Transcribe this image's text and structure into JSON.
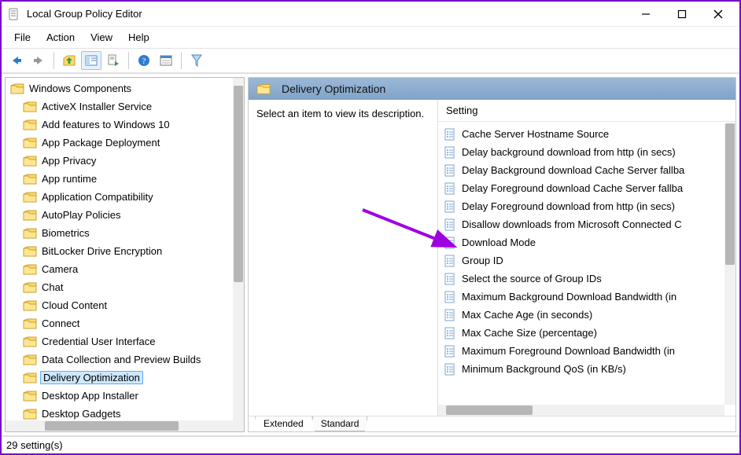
{
  "window": {
    "title": "Local Group Policy Editor"
  },
  "menu": {
    "file": "File",
    "action": "Action",
    "view": "View",
    "help": "Help"
  },
  "tree": {
    "root": "Windows Components",
    "items": [
      "ActiveX Installer Service",
      "Add features to Windows 10",
      "App Package Deployment",
      "App Privacy",
      "App runtime",
      "Application Compatibility",
      "AutoPlay Policies",
      "Biometrics",
      "BitLocker Drive Encryption",
      "Camera",
      "Chat",
      "Cloud Content",
      "Connect",
      "Credential User Interface",
      "Data Collection and Preview Builds",
      "Delivery Optimization",
      "Desktop App Installer",
      "Desktop Gadgets"
    ],
    "selected_index": 15
  },
  "details": {
    "header": "Delivery Optimization",
    "description": "Select an item to view its description.",
    "column_header": "Setting",
    "settings": [
      "Cache Server Hostname Source",
      "Delay background download from http (in secs)",
      "Delay Background download Cache Server fallba",
      "Delay Foreground download Cache Server fallba",
      "Delay Foreground download from http (in secs)",
      "Disallow downloads from Microsoft Connected C",
      "Download Mode",
      "Group ID",
      "Select the source of Group IDs",
      "Maximum Background Download Bandwidth (in",
      "Max Cache Age (in seconds)",
      "Max Cache Size (percentage)",
      "Maximum Foreground Download Bandwidth (in",
      "Minimum Background QoS (in KB/s)"
    ]
  },
  "tabs": {
    "extended": "Extended",
    "standard": "Standard",
    "active": "extended"
  },
  "status": {
    "text": "29 setting(s)"
  }
}
